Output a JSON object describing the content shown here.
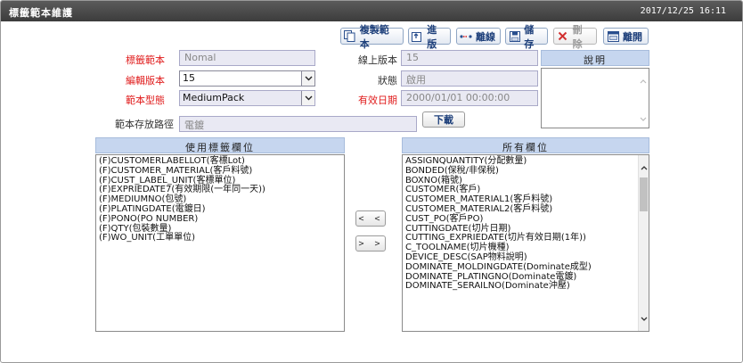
{
  "window": {
    "title": "標籤範本維護",
    "datetime": "2017/12/25 16:11"
  },
  "toolbar": {
    "copy_label": "複製範本",
    "version_label": "進版",
    "offline_label": "離線",
    "save_label": "儲存",
    "delete_label": "刪除",
    "exit_label": "離開"
  },
  "form": {
    "template_label": "標籤範本",
    "template_value": "Nomal",
    "edit_version_label": "編輯版本",
    "edit_version_value": "15",
    "template_type_label": "範本型態",
    "template_type_value": "MediumPack",
    "storage_path_label": "範本存放路徑",
    "storage_path_value": "電鍍",
    "online_version_label": "線上版本",
    "online_version_value": "15",
    "status_label": "狀態",
    "status_value": "啟用",
    "effective_date_label": "有效日期",
    "effective_date_value": "2000/01/01 00:00:00",
    "description_label": "說明",
    "download_label": "下載"
  },
  "used_fields": {
    "header": "使用標籤欄位",
    "items": [
      "(F)CUSTOMERLABELLOT(客標Lot)",
      "(F)CUSTOMER_MATERIAL(客戶料號)",
      "(F)CUST_LABEL_UNIT(客標單位)",
      "(F)EXPRIEDATE7(有效期限(一年同一天))",
      "(F)MEDIUMNO(包號)",
      "(F)PLATINGDATE(電鍍日)",
      "(F)PONO(PO NUMBER)",
      "(F)QTY(包裝數量)",
      "(F)WO_UNIT(工單單位)"
    ]
  },
  "move": {
    "left_label": "< <",
    "right_label": "> >"
  },
  "all_fields": {
    "header": "所有欄位",
    "items": [
      "ASSIGNQUANTITY(分配數量)",
      "BONDED(保稅/非保稅)",
      "BOXNO(箱號)",
      "CUSTOMER(客戶)",
      "CUSTOMER_MATERIAL1(客戶料號)",
      "CUSTOMER_MATERIAL2(客戶料號)",
      "CUST_PO(客戶PO)",
      "CUTTINGDATE(切片日期)",
      "CUTTING_EXPRIEDATE(切片有效日期(1年))",
      "C_TOOLNAME(切片機種)",
      "DEVICE_DESC(SAP物料說明)",
      "DOMINATE_MOLDINGDATE(Dominate成型)",
      "DOMINATE_PLATINGNO(Dominate電鍍)",
      "DOMINATE_SERAILNO(Dominate沖壓)"
    ]
  },
  "icons": {
    "copy": "copy-icon",
    "version": "version-up-icon",
    "offline": "offline-icon",
    "save": "floppy-icon",
    "delete": "x-icon",
    "exit": "exit-icon"
  },
  "colors": {
    "title_bar": "#3c3c3c",
    "required_label": "#e01b1b",
    "panel_header": "#c6d6ef",
    "readonly_field": "#e9e9f3"
  }
}
